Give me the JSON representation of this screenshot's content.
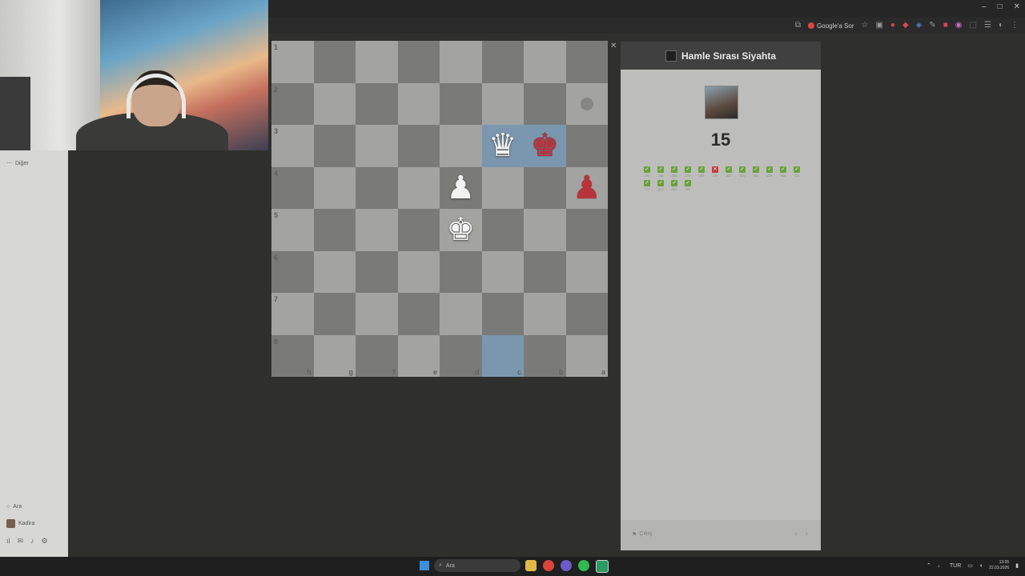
{
  "browser": {
    "google_button_label": "Google'a Sor",
    "window_controls": [
      "–",
      "□",
      "✕"
    ],
    "toolbar_icons": [
      "install-icon",
      "star-icon",
      "extension-icon",
      "menu-icon",
      "profile-icon"
    ]
  },
  "sidebar": {
    "more_label": "Diğer",
    "search_label": "Ara",
    "profile_label": "Kadira"
  },
  "board": {
    "rank_labels": [
      "1",
      "2",
      "3",
      "4",
      "5",
      "6",
      "7",
      "8"
    ],
    "file_labels": [
      "h",
      "g",
      "f",
      "e",
      "d",
      "c",
      "b",
      "a"
    ],
    "orientation": "black-bottom",
    "pieces": [
      {
        "square": "c3",
        "piece": "queen",
        "color": "white",
        "glyph": "♛"
      },
      {
        "square": "b3",
        "piece": "king",
        "color": "black",
        "glyph": "♚"
      },
      {
        "square": "d4",
        "piece": "pawn",
        "color": "white",
        "glyph": "♟"
      },
      {
        "square": "a4",
        "piece": "pawn",
        "color": "black",
        "glyph": "♟"
      },
      {
        "square": "d5",
        "piece": "king",
        "color": "white",
        "glyph": "♚"
      }
    ],
    "highlighted_squares": [
      "c3",
      "b3",
      "c8"
    ],
    "move_hint_squares": [
      "a2"
    ],
    "colors": {
      "light": "#a3a3a1",
      "dark": "#7a7a78",
      "highlight": "#7b97b0",
      "white_piece": "#f2f2f2",
      "black_piece": "#b8333a"
    }
  },
  "panel": {
    "title": "Hamle Sırası Siyahta",
    "score": "15",
    "results": [
      {
        "status": "ok",
        "time": "180"
      },
      {
        "status": "ok",
        "time": "244"
      },
      {
        "status": "ok",
        "time": "260"
      },
      {
        "status": "ok",
        "time": "279"
      },
      {
        "status": "ok",
        "time": "300"
      },
      {
        "status": "bad",
        "time": "409"
      },
      {
        "status": "ok",
        "time": "417"
      },
      {
        "status": "ok",
        "time": "525"
      },
      {
        "status": "ok",
        "time": "554"
      },
      {
        "status": "ok",
        "time": "626"
      },
      {
        "status": "ok",
        "time": "666"
      },
      {
        "status": "ok",
        "time": "725"
      },
      {
        "status": "ok",
        "time": "777"
      },
      {
        "status": "ok",
        "time": "833"
      },
      {
        "status": "ok",
        "time": "881"
      },
      {
        "status": "ok",
        "time": "905"
      }
    ],
    "exit_label": "Çıkış",
    "prev_label": "‹",
    "next_label": "›"
  },
  "taskbar": {
    "search_placeholder": "Ara",
    "language": "TUR",
    "time": "13:05",
    "date": "22.03.2026"
  }
}
